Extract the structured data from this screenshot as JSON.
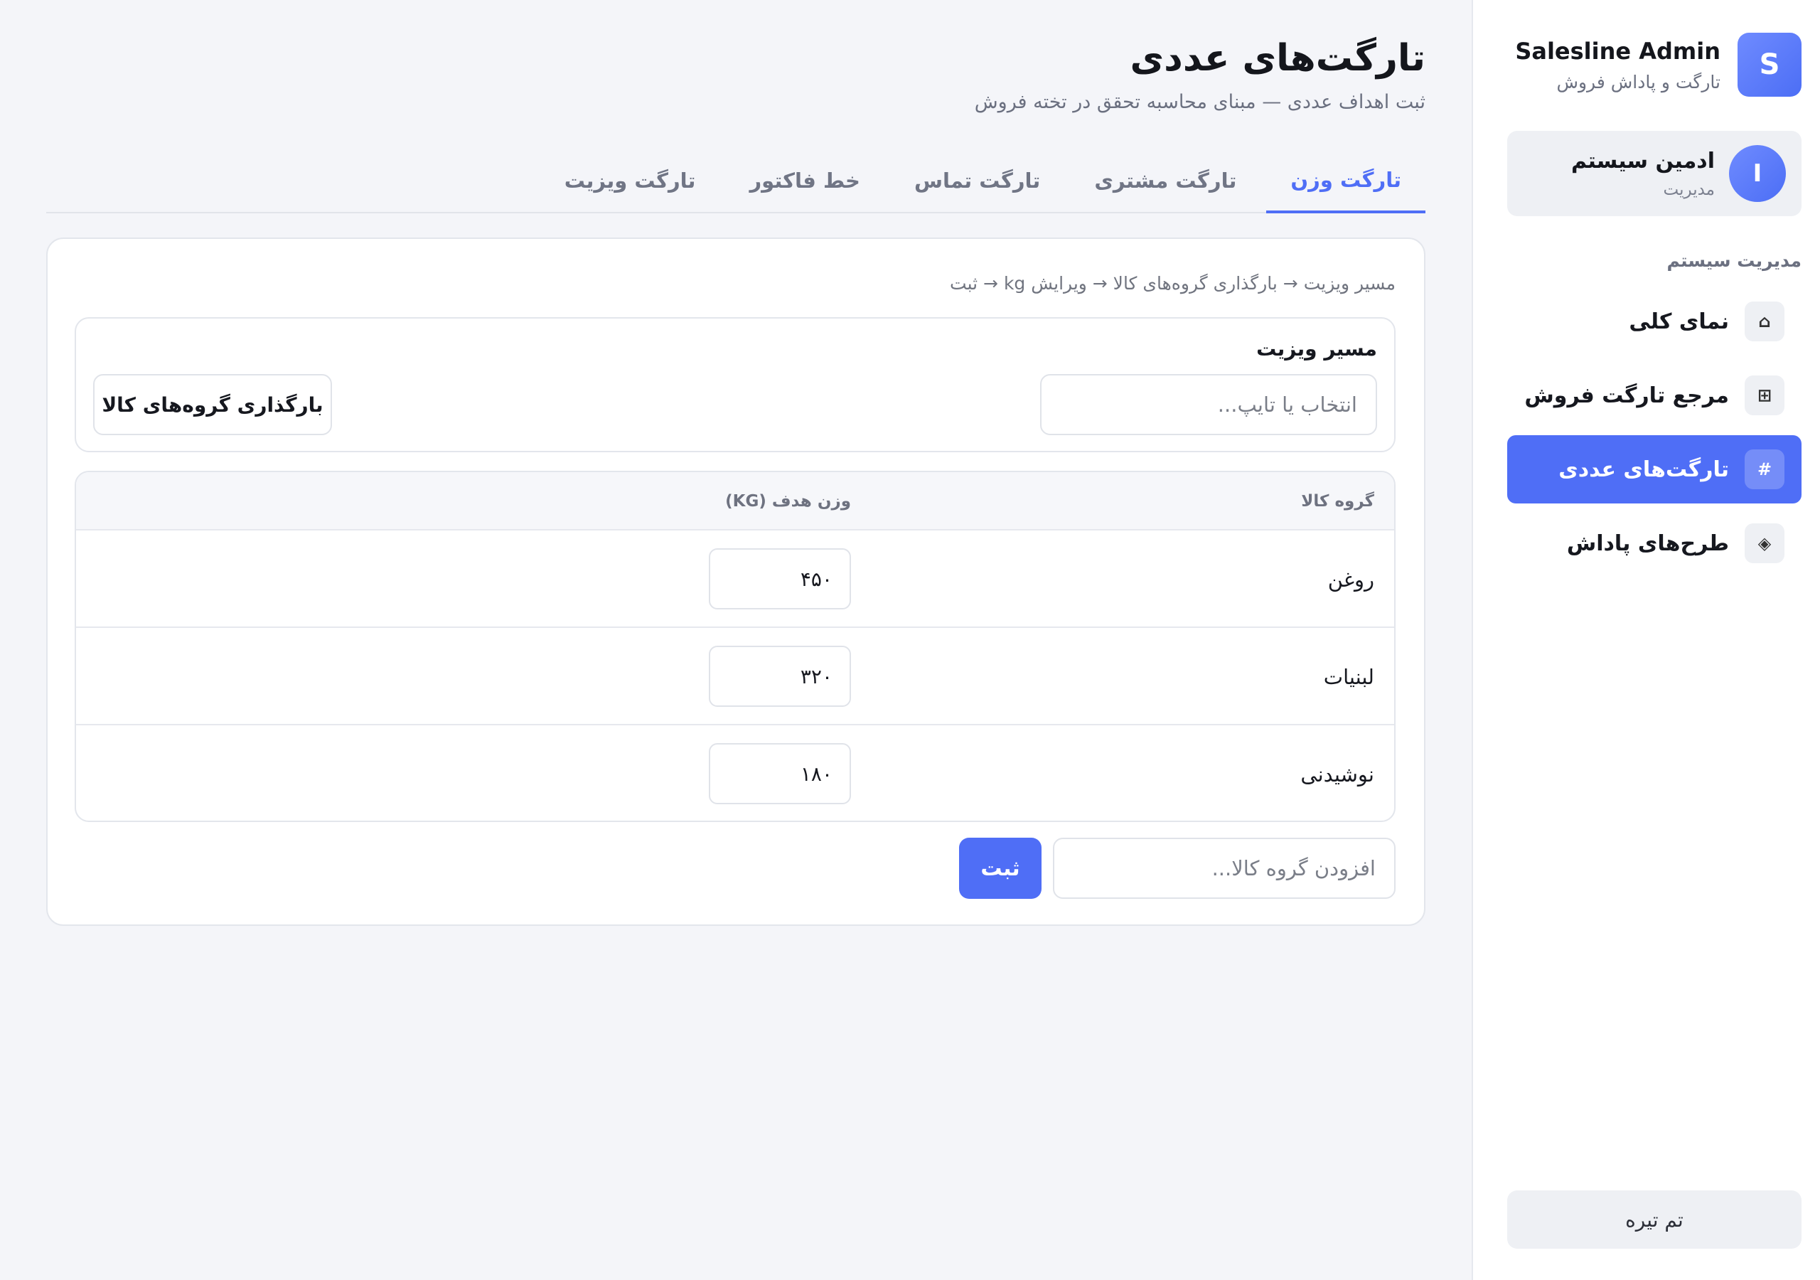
{
  "sidebar": {
    "brand": {
      "logo_letter": "S",
      "title": "Salesline Admin",
      "subtitle": "تارگت و پاداش فروش"
    },
    "user": {
      "avatar_letter": "I",
      "name": "ادمین سیستم",
      "role": "مدیریت"
    },
    "section_title": "مدیریت سیستم",
    "items": [
      {
        "icon": "home-icon",
        "glyph": "⌂",
        "label": "نمای کلی",
        "active": false
      },
      {
        "icon": "grid-icon",
        "glyph": "⊞",
        "label": "مرجع تارگت فروش",
        "active": false
      },
      {
        "icon": "hash-icon",
        "glyph": "#",
        "label": "تارگت‌های عددی",
        "active": true
      },
      {
        "icon": "diamond-icon",
        "glyph": "◈",
        "label": "طرح‌های پاداش",
        "active": false
      }
    ],
    "theme_button": "تم تیره"
  },
  "main": {
    "title": "تارگت‌های عددی",
    "subtitle": "ثبت اهداف عددی — مبنای محاسبه تحقق در تخته فروش",
    "tabs": [
      {
        "label": "تارگت وزن",
        "active": true
      },
      {
        "label": "تارگت مشتری",
        "active": false
      },
      {
        "label": "تارگت تماس",
        "active": false
      },
      {
        "label": "خط فاکتور",
        "active": false
      },
      {
        "label": "تارگت ویزیت",
        "active": false
      }
    ],
    "breadcrumb": "مسیر ویزیت → بارگذاری گروه‌های کالا → ویرایش kg → ثبت",
    "route": {
      "label": "مسیر ویزیت",
      "placeholder": "انتخاب یا تایپ...",
      "load_button": "بارگذاری گروه‌های کالا"
    },
    "table": {
      "headers": {
        "group": "گروه کالا",
        "weight": "وزن هدف (KG)"
      },
      "rows": [
        {
          "name": "روغن",
          "value": "۴۵۰"
        },
        {
          "name": "لبنیات",
          "value": "۳۲۰"
        },
        {
          "name": "نوشیدنی",
          "value": "۱۸۰"
        }
      ]
    },
    "add": {
      "placeholder": "افزودن گروه کالا...",
      "submit": "ثبت"
    }
  },
  "colors": {
    "accent": "#4f6ef6",
    "background": "#f4f5f9"
  }
}
